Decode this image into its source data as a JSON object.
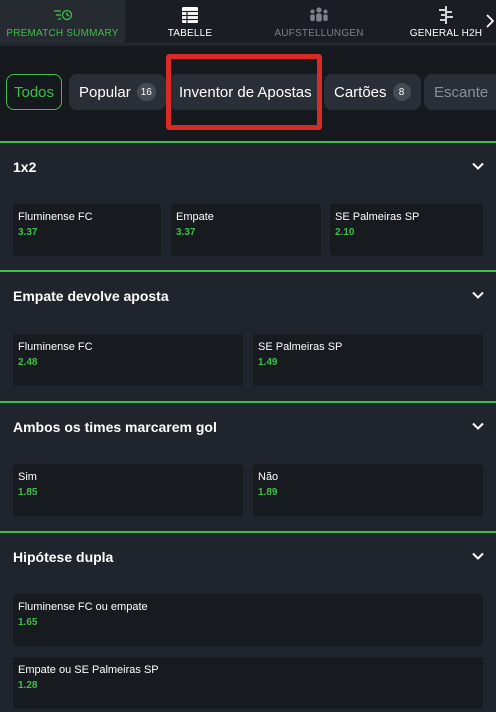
{
  "top_tabs": [
    {
      "label": "PREMATCH SUMMARY",
      "icon": "summary-icon",
      "state": "active"
    },
    {
      "label": "TABELLE",
      "icon": "table-icon",
      "state": "normal"
    },
    {
      "label": "AUFSTELLUNGEN",
      "icon": "lineup-icon",
      "state": "disabled"
    },
    {
      "label": "GENERAL H2H",
      "icon": "h2h-icon",
      "state": "normal"
    }
  ],
  "chips": [
    {
      "label": "Todos",
      "badge": null,
      "selected": true
    },
    {
      "label": "Popular",
      "badge": "16",
      "selected": false
    },
    {
      "label": "Inventor de Apostas",
      "badge": null,
      "selected": false
    },
    {
      "label": "Cartões",
      "badge": "8",
      "selected": false
    },
    {
      "label": "Escante",
      "badge": null,
      "selected": false
    }
  ],
  "markets": [
    {
      "title": "1x2",
      "options": [
        {
          "name": "Fluminense FC",
          "odd": "3.37"
        },
        {
          "name": "Empate",
          "odd": "3.37"
        },
        {
          "name": "SE Palmeiras SP",
          "odd": "2.10"
        }
      ]
    },
    {
      "title": "Empate devolve aposta",
      "options": [
        {
          "name": "Fluminense FC",
          "odd": "2.48"
        },
        {
          "name": "SE Palmeiras SP",
          "odd": "1.49"
        }
      ]
    },
    {
      "title": "Ambos os times marcarem gol",
      "options": [
        {
          "name": "Sim",
          "odd": "1.85"
        },
        {
          "name": "Não",
          "odd": "1.89"
        }
      ]
    },
    {
      "title": "Hipótese dupla",
      "options": [
        {
          "name": "Fluminense FC ou empate",
          "odd": "1.65"
        },
        {
          "name": "Empate ou SE Palmeiras SP",
          "odd": "1.28"
        }
      ]
    }
  ],
  "colors": {
    "accent": "#3fbf4a",
    "highlight": "#d92b25",
    "background": "#20242c"
  }
}
